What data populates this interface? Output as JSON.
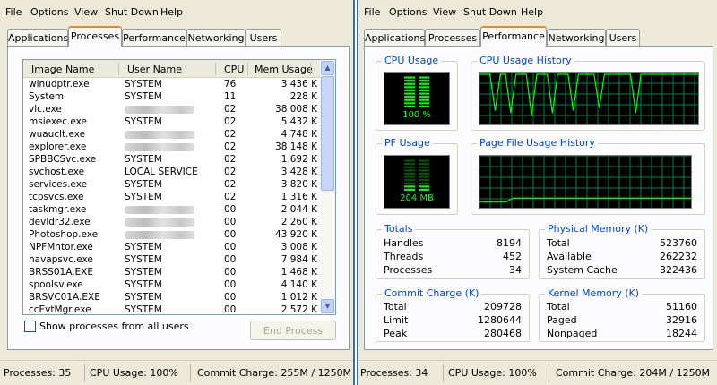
{
  "menu": [
    "File",
    "Options",
    "View",
    "Shut Down",
    "Help"
  ],
  "tabs": [
    "Applications",
    "Processes",
    "Performance",
    "Networking",
    "Users"
  ],
  "proc": {
    "columns": [
      "Image Name",
      "User Name",
      "CPU",
      "Mem Usage"
    ],
    "rows": [
      {
        "name": "winudptr.exe",
        "user": "SYSTEM",
        "cpu": "76",
        "mem": "3 436 K"
      },
      {
        "name": "System",
        "user": "SYSTEM",
        "cpu": "11",
        "mem": "228 K"
      },
      {
        "name": "vlc.exe",
        "user": "",
        "cpu": "02",
        "mem": "38 008 K"
      },
      {
        "name": "msiexec.exe",
        "user": "SYSTEM",
        "cpu": "02",
        "mem": "5 432 K"
      },
      {
        "name": "wuauclt.exe",
        "user": "",
        "cpu": "02",
        "mem": "4 748 K"
      },
      {
        "name": "explorer.exe",
        "user": "",
        "cpu": "02",
        "mem": "38 148 K"
      },
      {
        "name": "SPBBCSvc.exe",
        "user": "SYSTEM",
        "cpu": "02",
        "mem": "1 692 K"
      },
      {
        "name": "svchost.exe",
        "user": "LOCAL SERVICE",
        "cpu": "02",
        "mem": "3 428 K"
      },
      {
        "name": "services.exe",
        "user": "SYSTEM",
        "cpu": "02",
        "mem": "3 820 K"
      },
      {
        "name": "tcpsvcs.exe",
        "user": "SYSTEM",
        "cpu": "02",
        "mem": "1 316 K"
      },
      {
        "name": "taskmgr.exe",
        "user": "",
        "cpu": "00",
        "mem": "2 044 K"
      },
      {
        "name": "devldr32.exe",
        "user": "",
        "cpu": "00",
        "mem": "2 260 K"
      },
      {
        "name": "Photoshop.exe",
        "user": "",
        "cpu": "00",
        "mem": "43 920 K"
      },
      {
        "name": "NPFMntor.exe",
        "user": "SYSTEM",
        "cpu": "00",
        "mem": "3 008 K"
      },
      {
        "name": "navapsvc.exe",
        "user": "SYSTEM",
        "cpu": "00",
        "mem": "7 984 K"
      },
      {
        "name": "BRSS01A.EXE",
        "user": "SYSTEM",
        "cpu": "00",
        "mem": "1 468 K"
      },
      {
        "name": "spoolsv.exe",
        "user": "SYSTEM",
        "cpu": "00",
        "mem": "4 140 K"
      },
      {
        "name": "BRSVC01A.EXE",
        "user": "SYSTEM",
        "cpu": "00",
        "mem": "1 012 K"
      },
      {
        "name": "ccEvtMgr.exe",
        "user": "SYSTEM",
        "cpu": "00",
        "mem": "2 572 K"
      }
    ],
    "show_all_label": "Show processes from all users",
    "end_process_label": "End Process"
  },
  "status1": {
    "processes": "Processes: 35",
    "cpu": "CPU Usage: 100%",
    "commit": "Commit Charge: 255M / 1250M"
  },
  "perf": {
    "cpu_usage_title": "CPU Usage",
    "cpu_usage_value": "100 %",
    "cpu_history_title": "CPU Usage History",
    "pf_usage_title": "PF Usage",
    "pf_usage_value": "204 MB",
    "pf_history_title": "Page File Usage History",
    "cpu_fraction": 1.0,
    "pf_fraction": 0.16,
    "cpu_history": [
      100,
      100,
      100,
      25,
      100,
      100,
      20,
      100,
      100,
      100,
      15,
      100,
      100,
      100,
      20,
      100,
      100,
      100,
      25,
      100,
      100,
      100,
      100,
      30,
      100,
      100,
      100,
      100,
      100,
      100,
      20,
      100,
      100,
      100,
      100,
      100,
      100,
      100,
      100,
      100,
      100,
      100,
      100
    ],
    "pf_history": [
      8,
      8,
      8,
      8,
      8,
      16,
      16,
      16,
      16,
      16,
      16,
      16,
      16,
      16,
      16,
      16,
      16,
      16,
      16,
      16,
      16,
      16,
      16,
      16,
      16,
      16,
      16,
      16,
      16,
      16,
      16,
      16,
      16
    ],
    "totals": {
      "title": "Totals",
      "rows": [
        [
          "Handles",
          "8194"
        ],
        [
          "Threads",
          "452"
        ],
        [
          "Processes",
          "34"
        ]
      ]
    },
    "physical": {
      "title": "Physical Memory (K)",
      "rows": [
        [
          "Total",
          "523760"
        ],
        [
          "Available",
          "262232"
        ],
        [
          "System Cache",
          "322436"
        ]
      ]
    },
    "commit": {
      "title": "Commit Charge (K)",
      "rows": [
        [
          "Total",
          "209728"
        ],
        [
          "Limit",
          "1280644"
        ],
        [
          "Peak",
          "280468"
        ]
      ]
    },
    "kernel": {
      "title": "Kernel Memory (K)",
      "rows": [
        [
          "Total",
          "51160"
        ],
        [
          "Paged",
          "32916"
        ],
        [
          "Nonpaged",
          "18244"
        ]
      ]
    }
  },
  "status2": {
    "processes": "Processes: 34",
    "cpu": "CPU Usage: 100%",
    "commit": "Commit Charge: 204M / 1250M"
  },
  "colors": {
    "graph_green": "#00ff00",
    "grid": "#008040",
    "tab_accent": "#e68b2c",
    "group_title": "#0046d5"
  }
}
